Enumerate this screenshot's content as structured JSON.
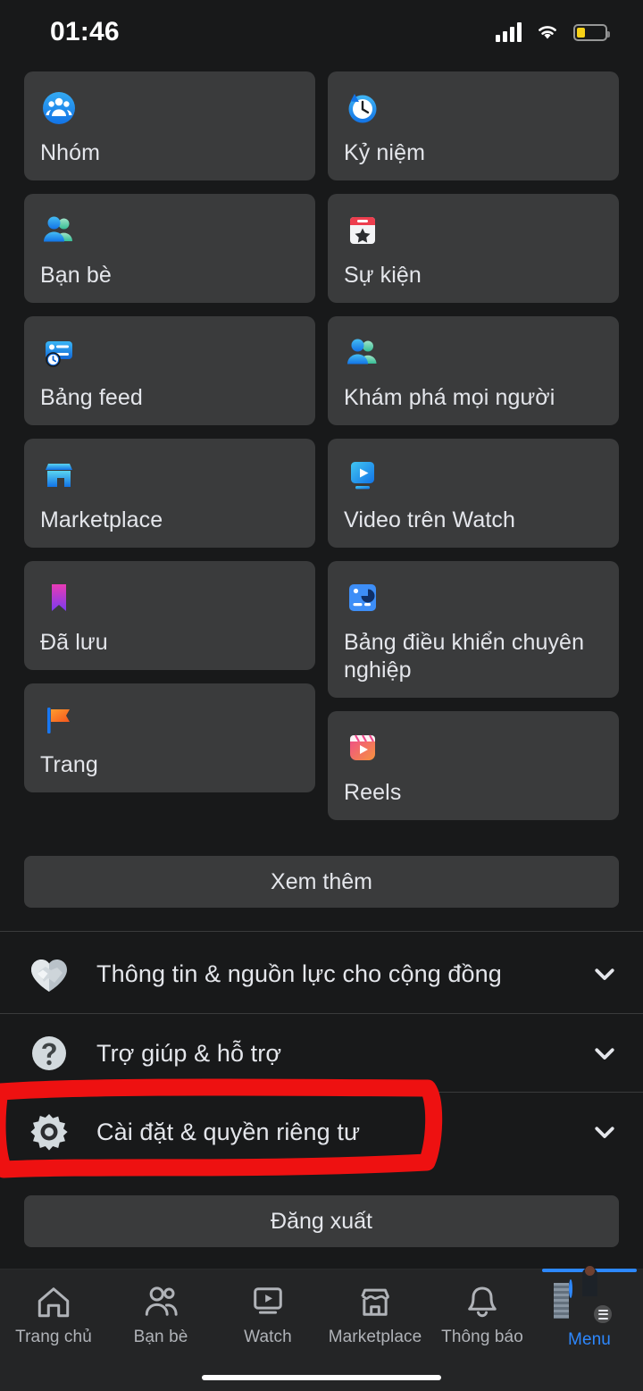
{
  "status_bar": {
    "time": "01:46",
    "signal_icon": "cellular-signal-icon",
    "wifi_icon": "wifi-icon",
    "battery_icon": "battery-low-icon"
  },
  "shortcuts": {
    "left_column": [
      {
        "label": "Nhóm",
        "icon": "groups-icon"
      },
      {
        "label": "Bạn bè",
        "icon": "friends-icon"
      },
      {
        "label": "Bảng feed",
        "icon": "feeds-icon"
      },
      {
        "label": "Marketplace",
        "icon": "marketplace-icon"
      },
      {
        "label": "Đã lưu",
        "icon": "saved-bookmark-icon"
      },
      {
        "label": "Trang",
        "icon": "pages-flag-icon"
      }
    ],
    "right_column": [
      {
        "label": "Kỷ niệm",
        "icon": "memories-clock-icon"
      },
      {
        "label": "Sự kiện",
        "icon": "events-calendar-icon"
      },
      {
        "label": "Khám phá mọi người",
        "icon": "discover-people-icon"
      },
      {
        "label": "Video trên Watch",
        "icon": "watch-video-icon"
      },
      {
        "label": "Bảng điều khiển chuyên nghiệp",
        "icon": "professional-dashboard-icon"
      },
      {
        "label": "Reels",
        "icon": "reels-icon"
      }
    ],
    "see_more_label": "Xem thêm"
  },
  "list_rows": [
    {
      "label": "Thông tin & nguồn lực cho cộng đồng",
      "icon": "handshake-heart-icon",
      "chevron": "chevron-down-icon"
    },
    {
      "label": "Trợ giúp & hỗ trợ",
      "icon": "help-question-icon",
      "chevron": "chevron-down-icon"
    },
    {
      "label": "Cài đặt & quyền riêng tư",
      "icon": "settings-gear-icon",
      "chevron": "chevron-down-icon"
    }
  ],
  "logout_label": "Đăng xuất",
  "tab_bar": {
    "tabs": [
      {
        "label": "Trang chủ",
        "icon": "home-icon",
        "active": false
      },
      {
        "label": "Bạn bè",
        "icon": "friends-icon",
        "active": false
      },
      {
        "label": "Watch",
        "icon": "watch-icon",
        "active": false
      },
      {
        "label": "Marketplace",
        "icon": "marketplace-icon",
        "active": false
      },
      {
        "label": "Thông báo",
        "icon": "bell-icon",
        "active": false
      },
      {
        "label": "Menu",
        "icon": "profile-avatar-menu-icon",
        "active": true
      }
    ]
  },
  "annotation": {
    "shape": "red-marker-rectangle",
    "color": "#ee1111",
    "targets": "Cài đặt & quyền riêng tư"
  },
  "colors": {
    "background": "#18191a",
    "tile": "#3a3b3c",
    "text_primary": "#e4e6eb",
    "accent_blue": "#2d88ff",
    "battery_yellow": "#f7d117",
    "annotation_red": "#ee1111"
  }
}
